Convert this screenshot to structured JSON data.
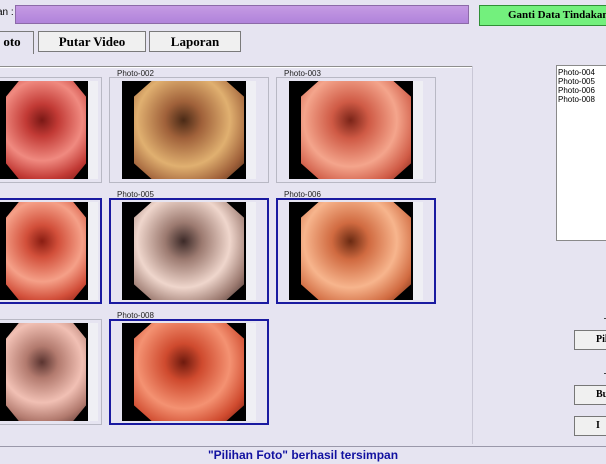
{
  "header": {
    "name_label": "an :",
    "name_value": "",
    "change_button": "Ganti Data Tindakan I"
  },
  "tabs": [
    {
      "label": "oto",
      "active": true
    },
    {
      "label": "Putar Video",
      "active": false
    },
    {
      "label": "Laporan",
      "active": false
    }
  ],
  "photos": [
    {
      "caption": "",
      "selected": false,
      "colors": [
        "#f08a80",
        "#c23a35",
        "#7a1815"
      ]
    },
    {
      "caption": "Photo-002",
      "selected": false,
      "colors": [
        "#e0b070",
        "#a0613a",
        "#4a2a16"
      ]
    },
    {
      "caption": "Photo-003",
      "selected": false,
      "colors": [
        "#f4a58c",
        "#cf5a45",
        "#7a2418"
      ]
    },
    {
      "caption": "",
      "selected": true,
      "colors": [
        "#f5a088",
        "#d24f3a",
        "#8a1d12"
      ]
    },
    {
      "caption": "Photo-005",
      "selected": true,
      "colors": [
        "#efd6cc",
        "#9c7a70",
        "#3c2a28"
      ]
    },
    {
      "caption": "Photo-006",
      "selected": true,
      "colors": [
        "#f7b58d",
        "#d06a40",
        "#6a2a12"
      ]
    },
    {
      "caption": "",
      "selected": false,
      "colors": [
        "#f1c0b4",
        "#b27a6e",
        "#5a3430"
      ]
    },
    {
      "caption": "Photo-008",
      "selected": true,
      "colors": [
        "#f49272",
        "#cf4a2e",
        "#6e1a0e"
      ]
    }
  ],
  "selected_list": [
    "Photo-004",
    "Photo-005",
    "Photo-006",
    "Photo-008"
  ],
  "side_buttons": [
    "",
    "Pil",
    "",
    "Bu",
    "I"
  ],
  "status_message": "\"Pilihan Foto\" berhasil tersimpan"
}
